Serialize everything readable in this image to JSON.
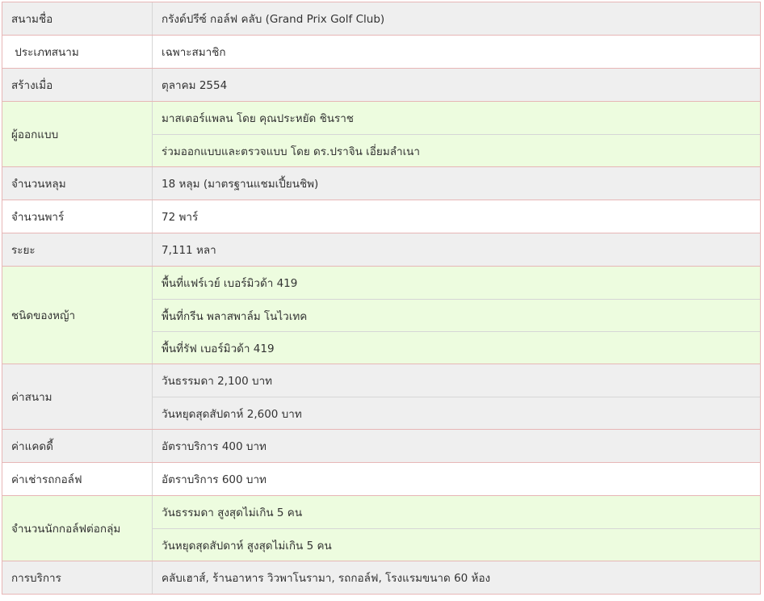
{
  "rows": [
    {
      "label": "สนามชื่อ",
      "values": [
        "กรังด์ปรีซ์ กอล์ฟ คลับ (Grand Prix Golf Club)"
      ],
      "bg": "gray"
    },
    {
      "label": " ประเภทสนาม",
      "values": [
        "เฉพาะสมาชิก"
      ],
      "bg": "white"
    },
    {
      "label": "สร้างเมื่อ",
      "values": [
        "ตุลาคม 2554"
      ],
      "bg": "gray"
    },
    {
      "label": "ผู้ออกแบบ",
      "values": [
        "มาสเตอร์แพลน โดย คุณประหยัด ชินราช",
        "ร่วมออกแบบและตรวจแบบ โดย ดร.ปราจิน เอี่ยมลำเนา"
      ],
      "bg": "green"
    },
    {
      "label": "จำนวนหลุม",
      "values": [
        "18 หลุม (มาตรฐานแชมเปี้ยนชิพ)"
      ],
      "bg": "gray"
    },
    {
      "label": "จำนวนพาร์",
      "values": [
        "72 พาร์"
      ],
      "bg": "white"
    },
    {
      "label": "ระยะ",
      "values": [
        "7,111 หลา"
      ],
      "bg": "gray"
    },
    {
      "label": "ชนิดของหญ้า",
      "values": [
        "พื้นที่แฟร์เวย์ เบอร์มิวด้า 419",
        "พื้นที่กรีน พลาสพาล์ม โนไวเทค",
        "พื้นที่รัฟ เบอร์มิวด้า 419"
      ],
      "bg": "green"
    },
    {
      "label": "ค่าสนาม",
      "values": [
        "วันธรรมดา 2,100 บาท",
        "วันหยุดสุดสัปดาห์ 2,600 บาท"
      ],
      "bg": "gray"
    },
    {
      "label": "ค่าแคดดี้",
      "values": [
        "อัตราบริการ 400 บาท"
      ],
      "bg": "gray"
    },
    {
      "label": "ค่าเช่ารถกอล์ฟ",
      "values": [
        "อัตราบริการ 600 บาท"
      ],
      "bg": "white"
    },
    {
      "label": "จำนวนนักกอล์ฟต่อกลุ่ม",
      "values": [
        "วันธรรมดา สูงสุดไม่เกิน 5 คน",
        "วันหยุดสุดสัปดาห์ สูงสุดไม่เกิน 5 คน"
      ],
      "bg": "green"
    },
    {
      "label": "การบริการ",
      "values": [
        "คลับเฮาส์, ร้านอาหาร วิวพาโนรามา, รถกอล์ฟ, โรงแรมขนาด 60 ห้อง"
      ],
      "bg": "gray"
    }
  ],
  "colors": {
    "gray": "#efefef",
    "white": "#ffffff",
    "green": "#edfcdf",
    "border": "#e7b6b6"
  }
}
